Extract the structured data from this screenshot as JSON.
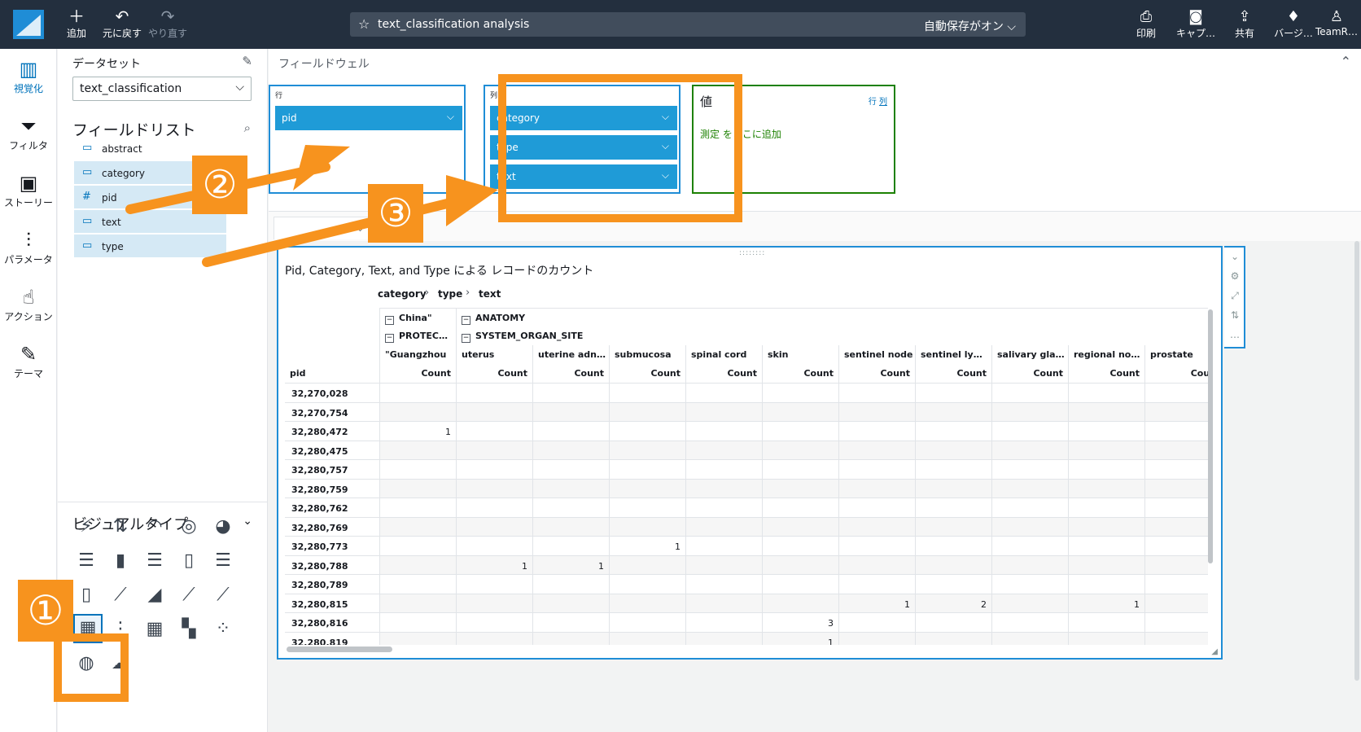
{
  "topbar": {
    "add": "追加",
    "undo": "元に戻す",
    "redo": "やり直す",
    "title": "text_classification analysis",
    "autosave": "自動保存がオン",
    "print": "印刷",
    "capture": "キャプ…",
    "share": "共有",
    "version": "バージ…",
    "team": "TeamR…"
  },
  "leftnav": {
    "visualize": "視覚化",
    "filter": "フィルタ",
    "story": "ストーリー",
    "params": "パラメータ",
    "action": "アクション",
    "theme": "テーマ"
  },
  "sidepanel": {
    "dataset_label": "データセット",
    "dataset": "text_classification",
    "fieldlist_title": "フィールドリスト",
    "fields": [
      {
        "name": "abstract",
        "type": "dimension",
        "selected": false
      },
      {
        "name": "category",
        "type": "dimension",
        "selected": true
      },
      {
        "name": "pid",
        "type": "measure",
        "selected": true
      },
      {
        "name": "text",
        "type": "dimension",
        "selected": true
      },
      {
        "name": "type",
        "type": "dimension",
        "selected": true
      }
    ],
    "visual_types_title": "ビジュアルタイプ"
  },
  "fieldwells": {
    "title": "フィールドウェル",
    "rows_label": "行",
    "rows": [
      "pid"
    ],
    "columns_label": "列",
    "columns": [
      "category",
      "type",
      "text"
    ],
    "values_label": "値",
    "values_link_rows": "行",
    "values_link_cols": "列",
    "values_add": "測定 をここに追加"
  },
  "visual": {
    "title": "Pid, Category, Text, and Type による レコードのカウント",
    "breadcrumb": [
      "category",
      "type",
      "text"
    ],
    "row_header": "pid",
    "col_group1": [
      "China\"",
      "ANATOMY"
    ],
    "col_group2": [
      "PROTEC…",
      "SYSTEM_ORGAN_SITE"
    ],
    "columns": [
      "\"Guangzhou",
      "uterus",
      "uterine adn…",
      "submucosa",
      "spinal cord",
      "skin",
      "sentinel node",
      "sentinel ly…",
      "salivary gla…",
      "regional no…",
      "prostate"
    ],
    "measure": "Count",
    "measure_last": "Coun",
    "rows": [
      {
        "pid": "32,270,028",
        "vals": [
          "",
          "",
          "",
          "",
          "",
          "",
          "",
          "",
          "",
          "",
          ""
        ]
      },
      {
        "pid": "32,270,754",
        "vals": [
          "",
          "",
          "",
          "",
          "",
          "",
          "",
          "",
          "",
          "",
          ""
        ]
      },
      {
        "pid": "32,280,472",
        "vals": [
          "1",
          "",
          "",
          "",
          "",
          "",
          "",
          "",
          "",
          "",
          ""
        ]
      },
      {
        "pid": "32,280,475",
        "vals": [
          "",
          "",
          "",
          "",
          "",
          "",
          "",
          "",
          "",
          "",
          ""
        ]
      },
      {
        "pid": "32,280,757",
        "vals": [
          "",
          "",
          "",
          "",
          "",
          "",
          "",
          "",
          "",
          "",
          ""
        ]
      },
      {
        "pid": "32,280,759",
        "vals": [
          "",
          "",
          "",
          "",
          "",
          "",
          "",
          "",
          "",
          "",
          ""
        ]
      },
      {
        "pid": "32,280,762",
        "vals": [
          "",
          "",
          "",
          "",
          "",
          "",
          "",
          "",
          "",
          "",
          ""
        ]
      },
      {
        "pid": "32,280,769",
        "vals": [
          "",
          "",
          "",
          "",
          "",
          "",
          "",
          "",
          "",
          "",
          ""
        ]
      },
      {
        "pid": "32,280,773",
        "vals": [
          "",
          "",
          "",
          "1",
          "",
          "",
          "",
          "",
          "",
          "",
          ""
        ]
      },
      {
        "pid": "32,280,788",
        "vals": [
          "",
          "1",
          "1",
          "",
          "",
          "",
          "",
          "",
          "",
          "",
          ""
        ]
      },
      {
        "pid": "32,280,789",
        "vals": [
          "",
          "",
          "",
          "",
          "",
          "",
          "",
          "",
          "",
          "",
          ""
        ]
      },
      {
        "pid": "32,280,815",
        "vals": [
          "",
          "",
          "",
          "",
          "",
          "",
          "1",
          "2",
          "",
          "1",
          ""
        ]
      },
      {
        "pid": "32,280,816",
        "vals": [
          "",
          "",
          "",
          "",
          "",
          "3",
          "",
          "",
          "",
          "",
          ""
        ]
      },
      {
        "pid": "32,280,819",
        "vals": [
          "",
          "",
          "",
          "",
          "",
          "1",
          "",
          "",
          "",
          "",
          ""
        ]
      }
    ]
  },
  "annotations": {
    "one": "①",
    "two": "②",
    "three": "③",
    "color": "#f7931e"
  }
}
